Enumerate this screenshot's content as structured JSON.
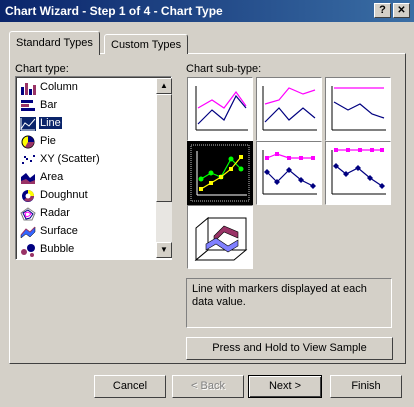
{
  "window": {
    "title": "Chart Wizard - Step 1 of 4 - Chart Type",
    "help_label": "?",
    "close_label": "✕"
  },
  "tabs": [
    {
      "label": "Standard Types"
    },
    {
      "label": "Custom Types"
    }
  ],
  "chart_type": {
    "label": "Chart type:",
    "items": [
      {
        "label": "Column",
        "icon": "column-chart-icon"
      },
      {
        "label": "Bar",
        "icon": "bar-chart-icon"
      },
      {
        "label": "Line",
        "icon": "line-chart-icon",
        "selected": true
      },
      {
        "label": "Pie",
        "icon": "pie-chart-icon"
      },
      {
        "label": "XY (Scatter)",
        "icon": "scatter-chart-icon"
      },
      {
        "label": "Area",
        "icon": "area-chart-icon"
      },
      {
        "label": "Doughnut",
        "icon": "doughnut-chart-icon"
      },
      {
        "label": "Radar",
        "icon": "radar-chart-icon"
      },
      {
        "label": "Surface",
        "icon": "surface-chart-icon"
      },
      {
        "label": "Bubble",
        "icon": "bubble-chart-icon"
      }
    ]
  },
  "chart_subtype": {
    "label": "Chart sub-type:",
    "selected_index": 3,
    "description": "Line with markers displayed at each data value."
  },
  "buttons": {
    "sample": "Press and Hold to View Sample",
    "cancel": "Cancel",
    "back": "< Back",
    "next": "Next >",
    "finish": "Finish"
  },
  "colors": {
    "titlebar": "#0a246a",
    "selection": "#0a246a",
    "series_magenta": "#ff00ff",
    "series_navy": "#000080"
  }
}
